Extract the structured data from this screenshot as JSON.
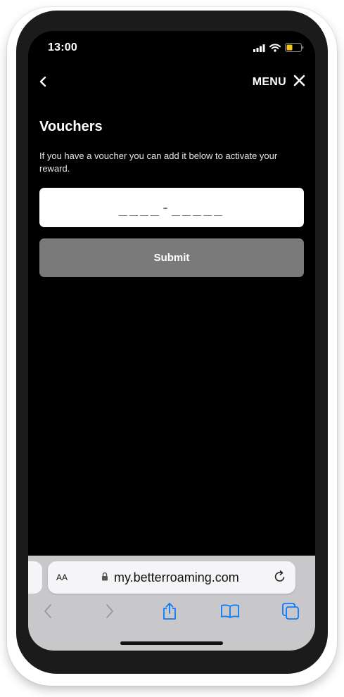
{
  "status_bar": {
    "time": "13:00",
    "icons": [
      "cellular-signal-icon",
      "wifi-icon",
      "battery-low-icon"
    ],
    "battery_color": "#f5c518"
  },
  "nav": {
    "back_icon": "chevron-left-icon",
    "menu_label": "MENU",
    "close_icon": "close-icon"
  },
  "page": {
    "title": "Vouchers",
    "description": "If you have a voucher you can add it below to activate your reward.",
    "voucher_placeholder": "____-_____",
    "submit_label": "Submit"
  },
  "browser": {
    "text_size_label": "AA",
    "url": "my.betterroaming.com",
    "lock_icon": "lock-icon",
    "reload_icon": "reload-icon",
    "toolbar_icons": [
      "back-icon",
      "forward-icon",
      "share-icon",
      "bookmarks-icon",
      "tabs-icon"
    ],
    "accent_color": "#0a7aff"
  }
}
